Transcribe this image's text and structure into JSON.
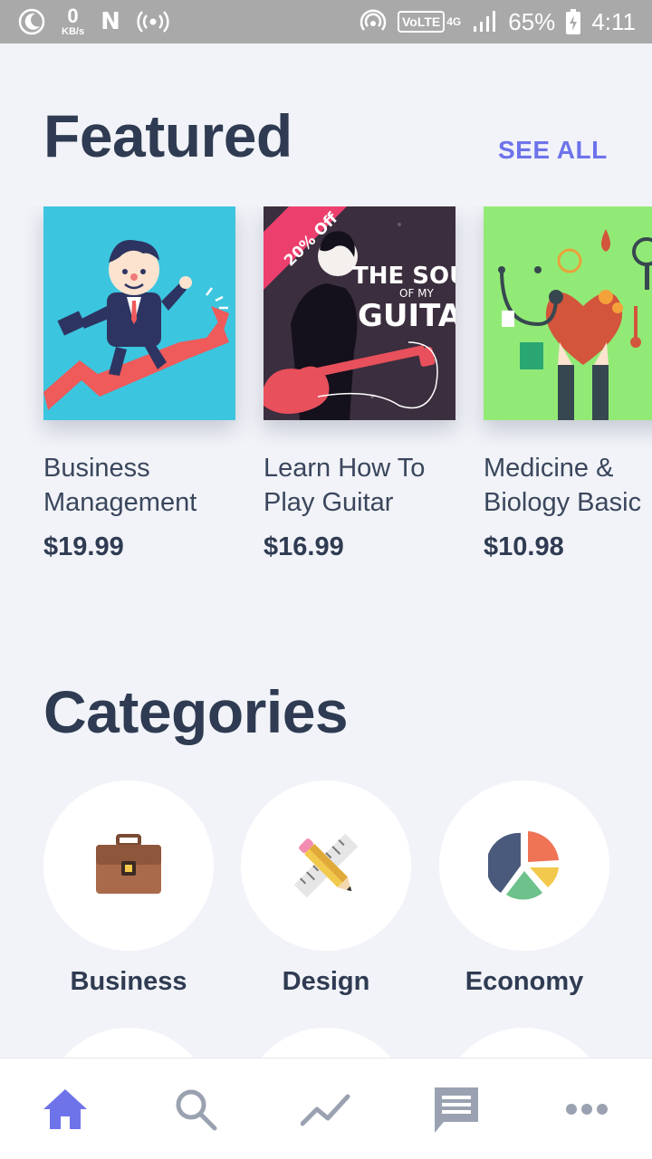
{
  "status_bar": {
    "speed_value": "0",
    "speed_unit": "KB/s",
    "network_badge": "VoLTE",
    "network_gen": "4G",
    "battery": "65%",
    "time": "4:11",
    "icons": [
      "moon-icon",
      "n-icon",
      "hotspot-icon",
      "wifi-hotspot-icon",
      "signal-icon",
      "battery-charging-icon"
    ]
  },
  "featured": {
    "title": "Featured",
    "see_all": "SEE ALL",
    "courses": [
      {
        "title_line1": "Business",
        "title_line2": "Management",
        "price": "$19.99",
        "thumb_color": "#3cc5df"
      },
      {
        "title_line1": "Learn How To",
        "title_line2": "Play Guitar",
        "price": "$16.99",
        "thumb_color": "#3b2e3e",
        "ribbon": "20% Off",
        "art_text_1": "THE SOUND",
        "art_text_2": "OF MY",
        "art_text_3": "GUITAR"
      },
      {
        "title_line1": "Medicine &",
        "title_line2": "Biology Basic",
        "price": "$10.98",
        "thumb_color": "#92ea76"
      }
    ]
  },
  "categories": {
    "title": "Categories",
    "items": [
      {
        "label": "Business",
        "icon": "briefcase-icon"
      },
      {
        "label": "Design",
        "icon": "ruler-pencil-icon"
      },
      {
        "label": "Economy",
        "icon": "pie-chart-icon"
      }
    ]
  },
  "bottom_nav": {
    "items": [
      {
        "icon": "home-icon",
        "active": true
      },
      {
        "icon": "search-icon",
        "active": false
      },
      {
        "icon": "trending-icon",
        "active": false
      },
      {
        "icon": "messages-icon",
        "active": false
      },
      {
        "icon": "more-icon",
        "active": false
      }
    ],
    "active_color": "#6e73ea",
    "inactive_color": "#9aa2b1"
  }
}
